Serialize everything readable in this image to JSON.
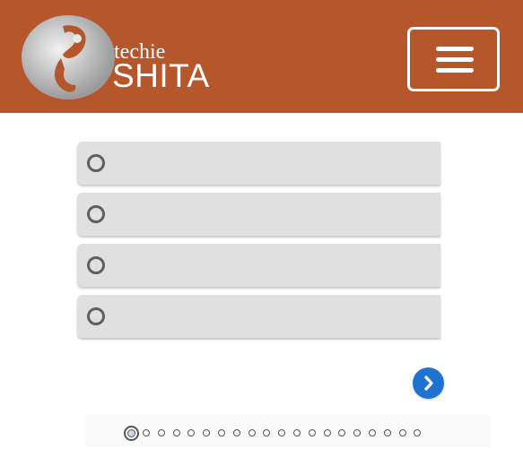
{
  "header": {
    "logo_small": "techie",
    "logo_big": "SHITA",
    "background": "#b5562b",
    "menu_icon": "hamburger-icon"
  },
  "quiz": {
    "options": [
      {
        "label": ""
      },
      {
        "label": ""
      },
      {
        "label": ""
      },
      {
        "label": ""
      }
    ],
    "next_icon": "chevron-right-icon",
    "next_color": "#1f72cf"
  },
  "pagination": {
    "total": 20,
    "current": 1
  }
}
